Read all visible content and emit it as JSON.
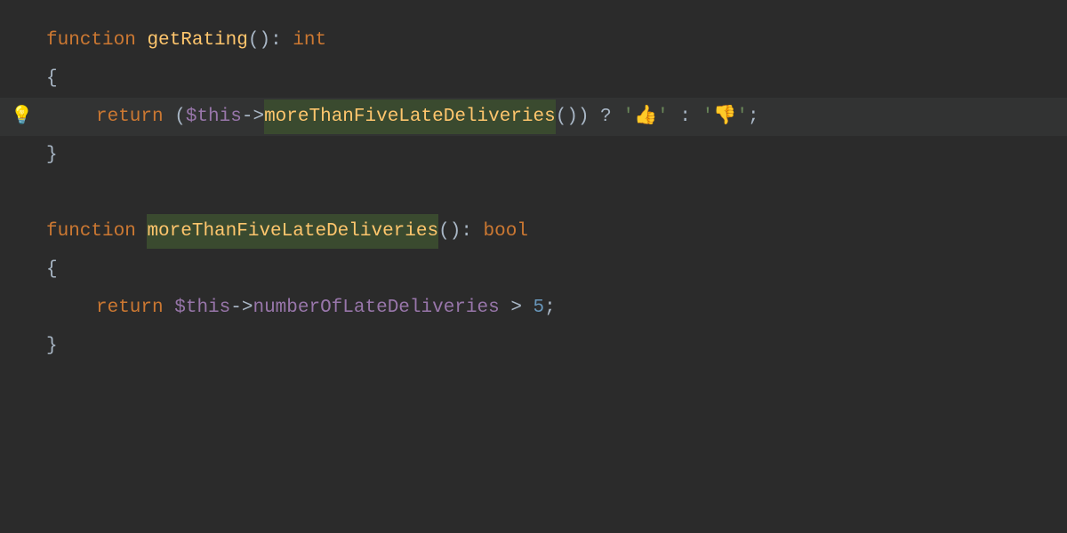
{
  "code": {
    "kw_function": "function",
    "kw_return": "return",
    "fn_getRating": "getRating",
    "fn_moreThan": "moreThanFiveLateDeliveries",
    "type_int": "int",
    "type_bool": "bool",
    "var_this": "$this",
    "prop_numberOfLateDeliveries": "numberOfLateDeliveries",
    "num_5": "5",
    "emoji_thumbs_up": "👍",
    "emoji_thumbs_down": "👎",
    "open_brace": "{",
    "close_brace": "}",
    "open_paren": "(",
    "close_paren": ")",
    "colon_sp": ": ",
    "arrow": "->",
    "q_open": " ? ",
    "q_colon": " : ",
    "sq": "'",
    "semi": ";",
    "gt_sp": " > "
  },
  "icons": {
    "bulb": "💡"
  }
}
